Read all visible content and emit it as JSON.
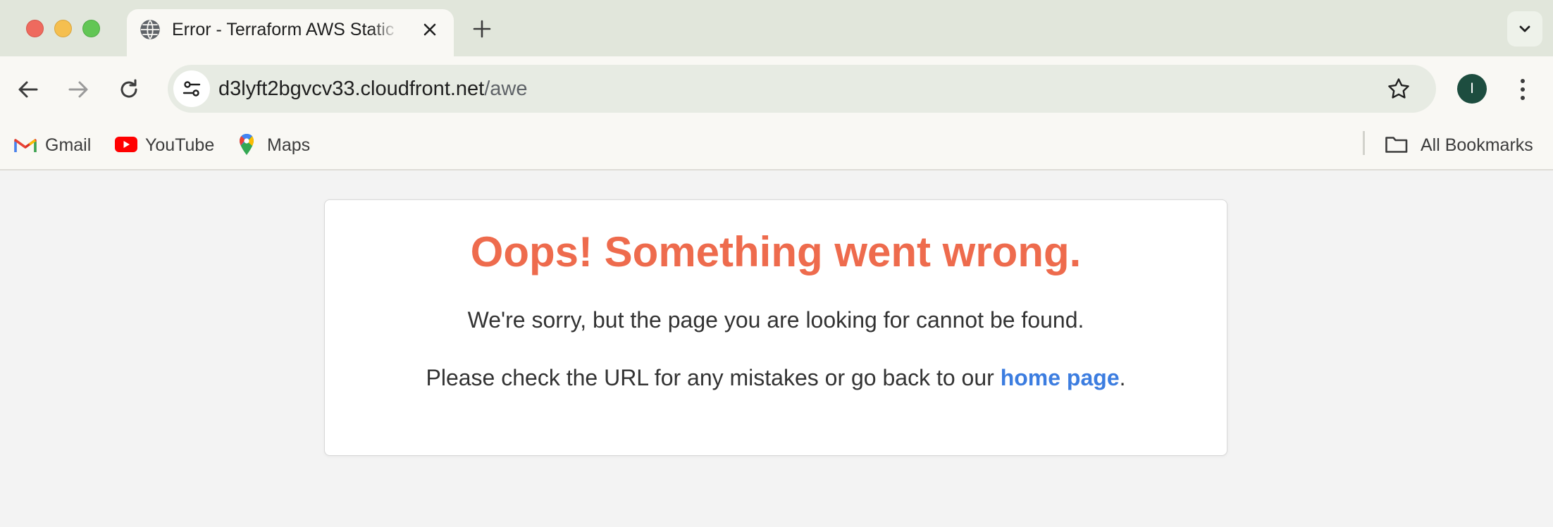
{
  "browser": {
    "tab": {
      "title": "Error - Terraform AWS Static Website",
      "favicon": "globe-icon"
    },
    "address_bar": {
      "host": "d3lyft2bgvcv33.cloudfront.net",
      "path": "/awe"
    },
    "profile_initial": "I",
    "profile_color": "#1d4d3f",
    "bookmarks": [
      {
        "label": "Gmail",
        "icon": "gmail-icon"
      },
      {
        "label": "YouTube",
        "icon": "youtube-icon"
      },
      {
        "label": "Maps",
        "icon": "maps-icon"
      }
    ],
    "all_bookmarks_label": "All Bookmarks"
  },
  "page": {
    "headline": "Oops! Something went wrong.",
    "message": "We're sorry, but the page you are looking for cannot be found.",
    "hint_prefix": "Please check the URL for any mistakes or go back to our ",
    "home_link_label": "home page",
    "hint_suffix": ".",
    "colors": {
      "headline": "#ee6b4d",
      "link": "#3c7de0"
    }
  }
}
